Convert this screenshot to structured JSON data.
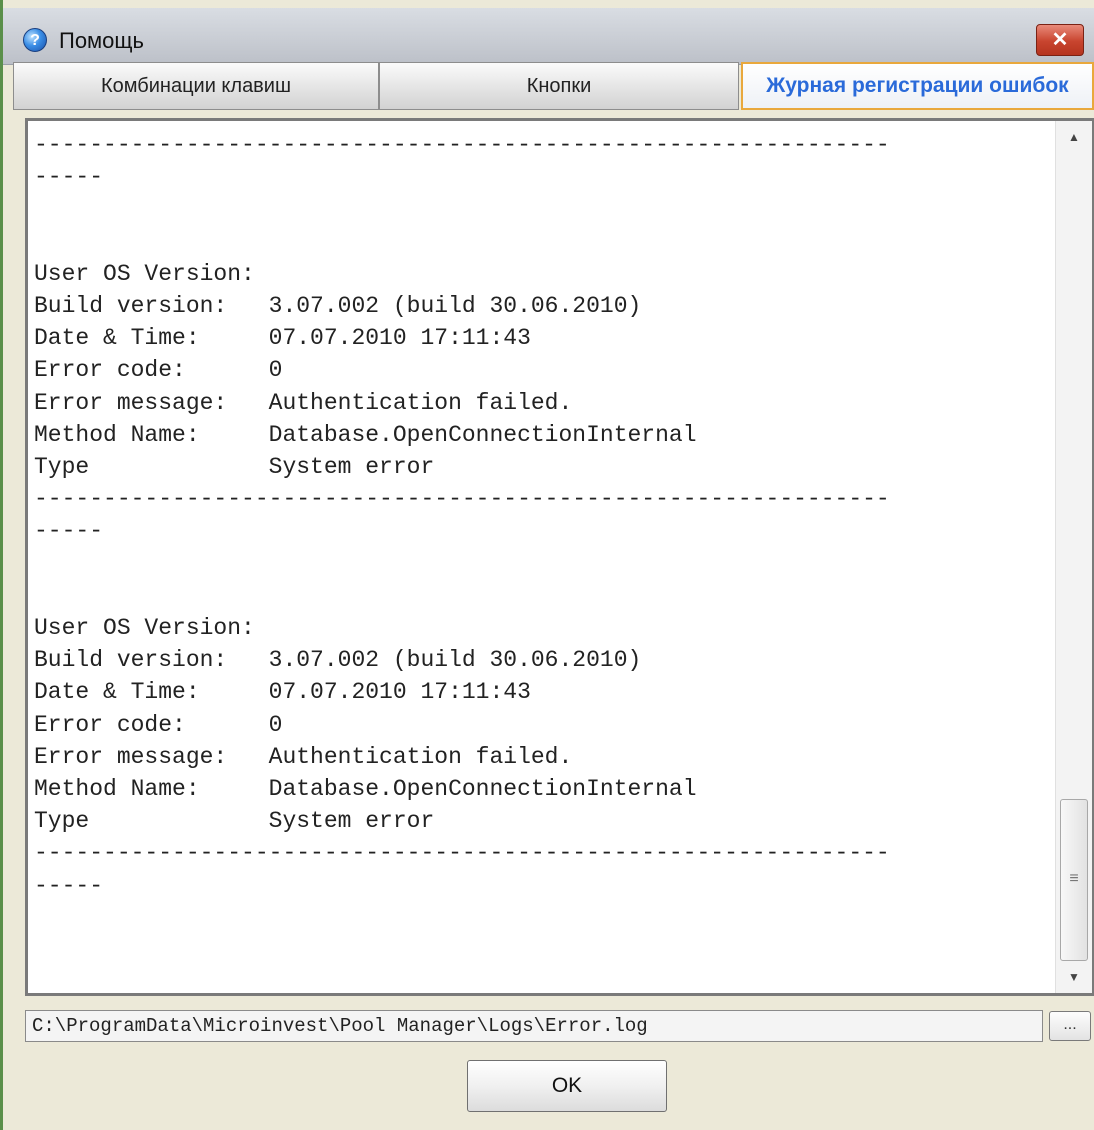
{
  "window": {
    "title": "Помощь",
    "close_glyph": "✕",
    "help_icon": "help-icon",
    "help_glyph": "?"
  },
  "tabs": [
    {
      "label": "Комбинации клавиш",
      "active": false
    },
    {
      "label": "Кнопки",
      "active": false
    },
    {
      "label": "Журная регистрации ошибок",
      "active": true
    }
  ],
  "log": {
    "lines": [
      "--------------------------------------------------------------",
      "-----",
      "",
      "",
      "User OS Version:",
      "Build version:   3.07.002 (build 30.06.2010)",
      "Date & Time:     07.07.2010 17:11:43",
      "Error code:      0",
      "Error message:   Authentication failed.",
      "Method Name:     Database.OpenConnectionInternal",
      "Type             System error",
      "--------------------------------------------------------------",
      "-----",
      "",
      "",
      "User OS Version:",
      "Build version:   3.07.002 (build 30.06.2010)",
      "Date & Time:     07.07.2010 17:11:43",
      "Error code:      0",
      "Error message:   Authentication failed.",
      "Method Name:     Database.OpenConnectionInternal",
      "Type             System error",
      "--------------------------------------------------------------",
      "-----"
    ],
    "scrollbar": {
      "up_glyph": "▲",
      "down_glyph": "▼",
      "thumb_glyph": "≡",
      "position": 0.95
    }
  },
  "footer": {
    "path_value": "C:\\ProgramData\\Microinvest\\Pool Manager\\Logs\\Error.log",
    "browse_label": "...",
    "ok_label": "OK"
  },
  "colors": {
    "active_tab_text": "#2a6ad9",
    "active_tab_border": "#e9a83c",
    "close_button": "#c8442e"
  }
}
